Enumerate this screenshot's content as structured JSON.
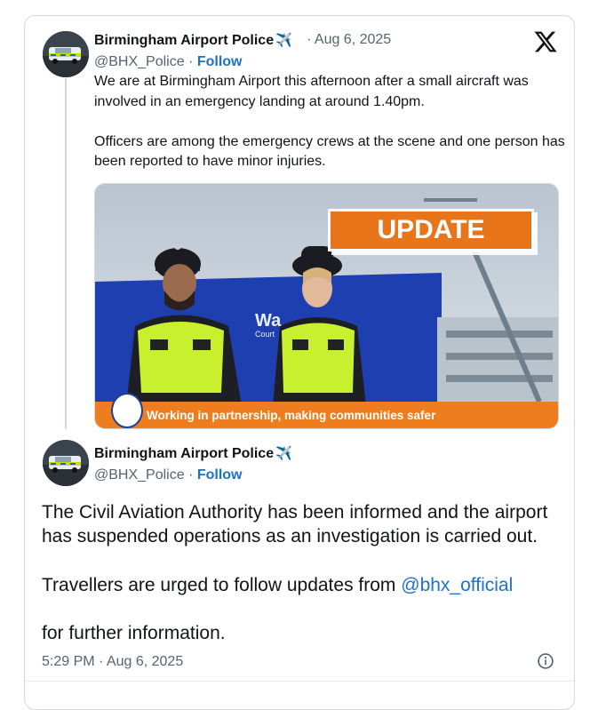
{
  "tweet1": {
    "display_name": "Birmingham Airport Police",
    "name_emoji": "✈️",
    "date": "· Aug 6, 2025",
    "handle": "@BHX_Police",
    "sep": " · ",
    "follow_label": "Follow",
    "text": "We are at Birmingham Airport this afternoon after a small aircraft was involved in an emergency landing at around 1.40pm.\n\nOfficers are among the emergency crews at the scene and one person has been reported to have minor injuries.",
    "image": {
      "update_label": "UPDATE",
      "banner_text": "Working in partnership, making communities safer",
      "sign_text": "Wa",
      "sign_sub": "Court"
    }
  },
  "tweet2": {
    "display_name": "Birmingham Airport Police",
    "name_emoji": "✈️",
    "handle": "@BHX_Police",
    "sep": " · ",
    "follow_label": "Follow",
    "text": "The Civil Aviation Authority has been informed and the airport has suspended operations as an investigation is carried out.\n\nTravellers are urged to follow updates from ",
    "mention": "@bhx_official",
    "text_tail": "for further information.",
    "timestamp": "5:29 PM · Aug 6, 2025"
  },
  "icons": {
    "platform_logo": "x-logo-icon",
    "info": "info-icon",
    "verified_plane": "airplane-emoji"
  },
  "colors": {
    "link": "#1d72c4",
    "muted": "#536471",
    "update_orange": "#e8751a",
    "border": "#cfd9de"
  }
}
